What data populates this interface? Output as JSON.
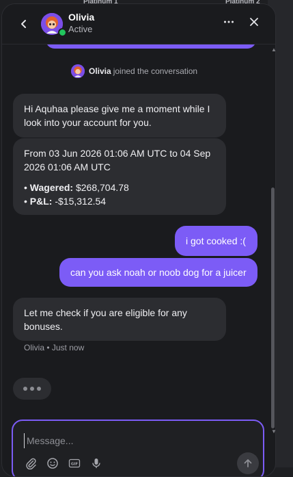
{
  "background": {
    "tab_left": "Platinum 1",
    "tab_right": "Platinum 2"
  },
  "header": {
    "back_icon": "chevron-left-icon",
    "agent_name": "Olivia",
    "agent_status": "Active",
    "more_icon": "more-horizontal-icon",
    "close_icon": "close-icon"
  },
  "conversation": {
    "join_notice": {
      "name": "Olivia",
      "text": "joined the conversation"
    },
    "messages": [
      {
        "sender": "agent",
        "text": "Hi Aquhaa please give me a moment while I look into your account for you."
      },
      {
        "sender": "agent",
        "range": "From 03 Jun 2026 01:06 AM UTC to 04 Sep 2026 01:06 AM UTC",
        "stats": [
          {
            "bullet": "•",
            "label": "Wagered:",
            "value": "$268,704.78"
          },
          {
            "bullet": "•",
            "label": "P&L:",
            "value": "-$15,312.54"
          }
        ]
      },
      {
        "sender": "user",
        "text": "i got cooked :("
      },
      {
        "sender": "user",
        "text": "can you ask noah or noob dog for a juicer"
      },
      {
        "sender": "agent",
        "text": "Let me check if you are eligible for any bonuses."
      }
    ],
    "last_meta": "Olivia • Just now",
    "typing_indicator": true
  },
  "composer": {
    "placeholder": "Message...",
    "value": "",
    "tools": [
      "paperclip-icon",
      "emoji-icon",
      "gif-icon",
      "microphone-icon"
    ],
    "send_icon": "arrow-up-icon"
  },
  "colors": {
    "accent": "#7c5cf6",
    "online": "#22c55e",
    "agent_bubble": "#2c2d31",
    "panel_bg": "#1a1b1e"
  }
}
